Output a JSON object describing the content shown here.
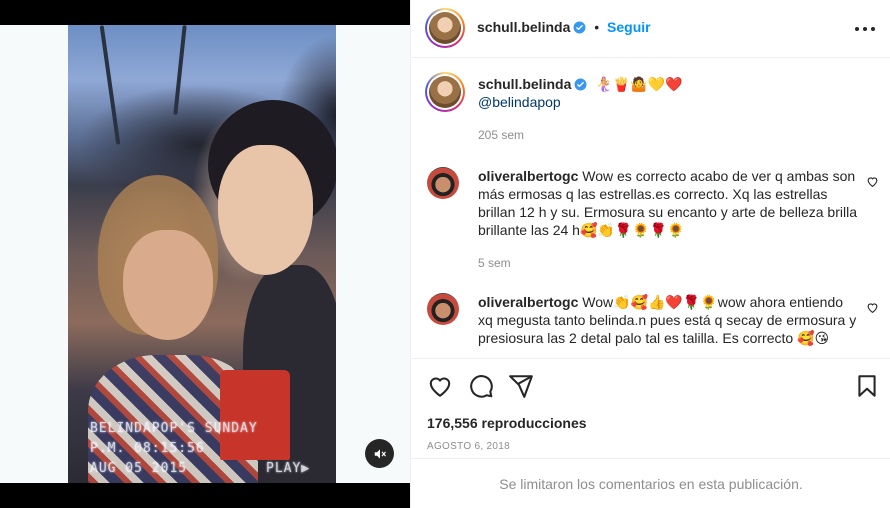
{
  "media": {
    "overlay_lines": [
      "BELINDAPOP'S SUNDAY",
      "P.M. 08:15:56",
      "AUG 05 2015",
      "PLAY▶"
    ],
    "mute_icon": "speaker-muted-icon"
  },
  "header": {
    "username": "schull.belinda",
    "follow_label": "Seguir",
    "separator": "•",
    "verified_icon": "verified-badge-icon",
    "more_icon": "more-options-icon"
  },
  "caption": {
    "username": "schull.belinda",
    "emojis": "🧜‍♀️🍟🤷💛❤️",
    "mention": "@belindapop",
    "time": "205 sem"
  },
  "comments": [
    {
      "username": "oliveralbertogc",
      "line1": "Wow es correcto acabo de ver q ambas son",
      "line2": "más ermosas q las estrellas.es correcto. Xq las estrellas",
      "line3": "brillan 12 h y su. Ermosura su encanto y arte de belleza brilla",
      "line4": "brillante las 24 h🥰👏🌹🌻🌹🌻",
      "time": "5 sem"
    },
    {
      "username": "oliveralbertogc",
      "line1": "Wow👏🥰👍❤️🌹🌻wow ahora entiendo",
      "line2": "xq megusta tanto belinda.n pues está q secay de ermosura y",
      "line3": "presiosura las 2 detal palo tal es talilla. Es correcto 🥰😘"
    }
  ],
  "actions": {
    "like_icon": "heart-icon",
    "comment_icon": "comment-icon",
    "share_icon": "share-icon",
    "save_icon": "bookmark-icon",
    "views": "176,556 reproducciones",
    "date": "AGOSTO 6, 2018",
    "comments_limited": "Se limitaron los comentarios en esta publicación."
  }
}
